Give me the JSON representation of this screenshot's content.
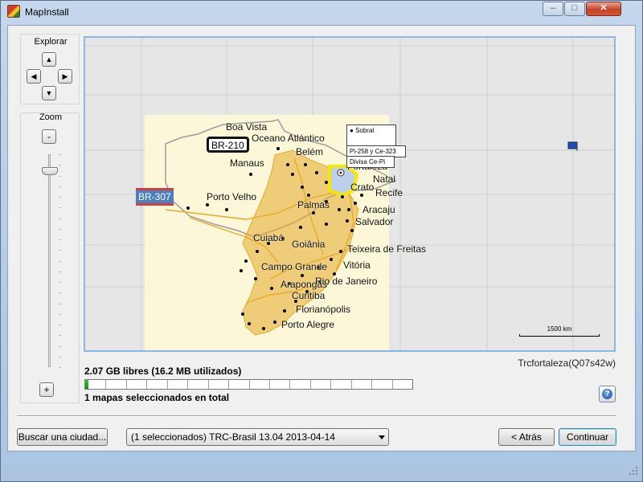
{
  "window": {
    "title": "MapInstall",
    "minimize_glyph": "–",
    "maximize_glyph": "□",
    "close_glyph": "✕"
  },
  "explore": {
    "title": "Explorar",
    "up_glyph": "▲",
    "down_glyph": "▼",
    "left_glyph": "◀",
    "right_glyph": "▶"
  },
  "zoom": {
    "title": "Zoom",
    "out_label": "-",
    "in_label": "+",
    "level_fraction": 0.08
  },
  "map": {
    "labels": {
      "boa_vista": "Boa Vista",
      "oceano": "Oceano Atlántico",
      "belem": "Belém",
      "fortaleza": "Fortaleza",
      "manaus": "Manaus",
      "natal": "Natal",
      "crato": "Crato",
      "recife": "Recife",
      "porto_velho": "Porto Velho",
      "palmas": "Palmas",
      "aracaju": "Aracaju",
      "salvador": "Salvador",
      "cuiaba": "Cuiabá",
      "goiania": "Goiânia",
      "teixeira": "Teixeira de Freitas",
      "campo_grande": "Campo Grande",
      "vitoria": "Vitória",
      "araponga": "Arapongas",
      "rio": "Rio de Janeiro",
      "curitiba": "Curitiba",
      "florianopolis": "Florianópolis",
      "porto_alegre": "Porto Alegre"
    },
    "shields": {
      "br210": "BR-210",
      "br307": "BR-307"
    },
    "popups": {
      "sobral": "Sobral",
      "pi": "Pi-258 y Ce-323",
      "divisa": "Divisa Ce-Pi"
    },
    "scale": "1500 km",
    "map_name": "Trcfortaleza(Q07s42w)",
    "colors": {
      "map_bg": "#e6e6e6",
      "coverage": "#fbf7d8",
      "roads": "#e6a928",
      "selection": "#f7e600",
      "border": "#9c9c9c"
    }
  },
  "storage": {
    "free_text": "2.07 GB libres (16.2 MB utilizados)",
    "used_fraction": 0.01,
    "selected_text": "1 mapas seleccionados en total"
  },
  "buttons": {
    "search_city": "Buscar una ciudad...",
    "map_selected": "(1 seleccionados) TRC-Brasil 13.04 2013-04-14",
    "back": "< Atrás",
    "continue": "Continuar",
    "help": "?"
  }
}
